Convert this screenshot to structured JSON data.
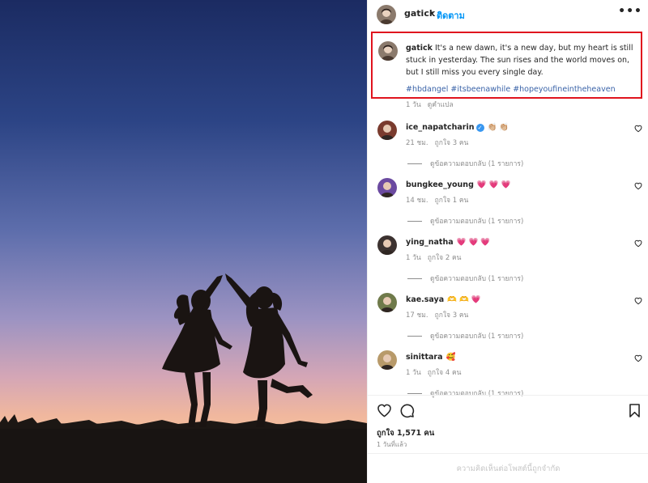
{
  "post": {
    "username": "gatick",
    "separator": "•",
    "follow_label": "ติดตาม",
    "more_label": "•••"
  },
  "caption": {
    "username": "gatick",
    "text": "It's a new dawn, it's a new day, but my heart is still stuck in yesterday. The sun rises and the world moves on, but I still miss you every single day.",
    "hashtags": "#hbdangel #itsbeenawhile #hopeyoufineintheheaven",
    "time": "1 วัน",
    "reply_label": "ดูคำแปล"
  },
  "comments": [
    {
      "username": "ice_napatcharin",
      "verified": true,
      "emoji": "👏🏼 👏🏼",
      "time": "21 ชม.",
      "likes": "ถูกใจ 3 คน",
      "replies": "ดูข้อความตอบกลับ (1 รายการ)",
      "avatar_color": "#7a3b2e"
    },
    {
      "username": "bungkee_young",
      "verified": false,
      "emoji": "💗 💗 💗",
      "time": "14 ชม.",
      "likes": "ถูกใจ 1 คน",
      "replies": "ดูข้อความตอบกลับ (1 รายการ)",
      "avatar_color": "#6b4aa0"
    },
    {
      "username": "ying_natha",
      "verified": false,
      "emoji": "💗 💗 💗",
      "time": "1 วัน",
      "likes": "ถูกใจ 2 คน",
      "replies": "ดูข้อความตอบกลับ (1 รายการ)",
      "avatar_color": "#3c3230"
    },
    {
      "username": "kae.saya",
      "verified": false,
      "emoji": "🫶 🫶 💗",
      "time": "17 ชม.",
      "likes": "ถูกใจ 3 คน",
      "replies": "ดูข้อความตอบกลับ (1 รายการ)",
      "avatar_color": "#6f7a4a"
    },
    {
      "username": "sinittara",
      "verified": false,
      "emoji": "🥰",
      "time": "1 วัน",
      "likes": "ถูกใจ 4 คน",
      "replies": "ดูข้อความตอบกลับ (1 รายการ)",
      "avatar_color": "#b89a6a"
    }
  ],
  "actions": {
    "likes_text": "ถูกใจ 1,571 คน",
    "post_time": "1 วันที่แล้ว",
    "comments_limited": "ความคิดเห็นต่อโพสต์นี้ถูกจำกัด"
  },
  "colors": {
    "highlight_box": "#e0141e",
    "link_blue": "#0095f6",
    "hashtag_blue": "#3a63a8",
    "verified_blue": "#3897f0",
    "muted_gray": "#8e8e8e"
  },
  "icons": {
    "more": "more-horizontal-icon",
    "like": "heart-icon",
    "comment": "comment-bubble-icon",
    "save": "bookmark-icon",
    "verified": "verified-badge-icon"
  }
}
